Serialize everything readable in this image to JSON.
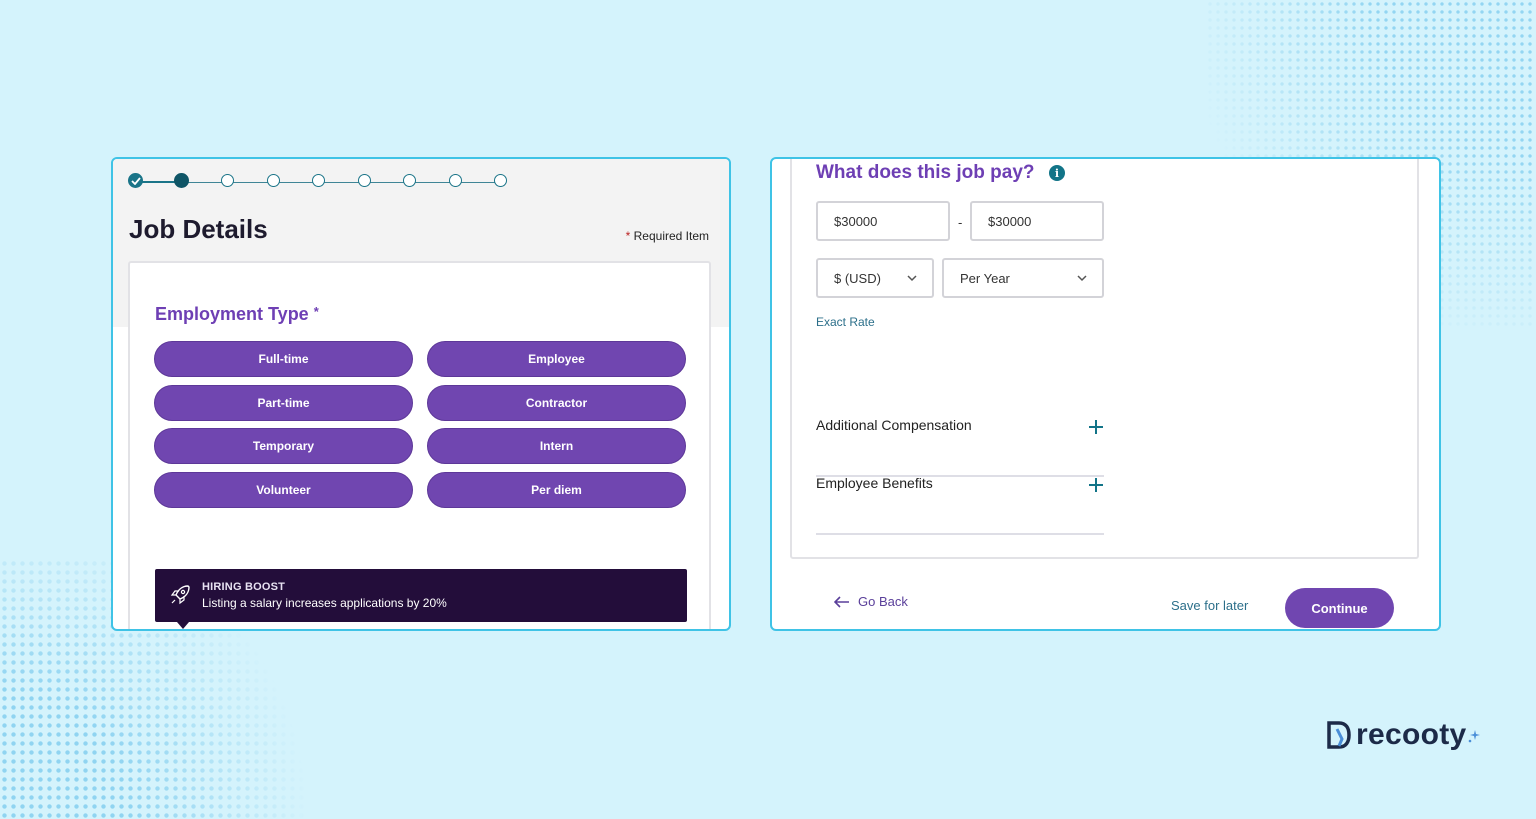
{
  "left": {
    "title": "Job Details",
    "required_star": "*",
    "required_label": "Required Item",
    "employment_heading": "Employment Type",
    "employment_star": "*",
    "options": [
      "Full-time",
      "Employee",
      "Part-time",
      "Contractor",
      "Temporary",
      "Intern",
      "Volunteer",
      "Per diem"
    ],
    "boost_title": "HIRING BOOST",
    "boost_text": "Listing a salary increases applications by 20%"
  },
  "right": {
    "heading": "What does this job pay?",
    "info_glyph": "i",
    "min_pay": "$30000",
    "dash": "-",
    "max_pay": "$30000",
    "currency": "$ (USD)",
    "period": "Per Year",
    "exact_rate": "Exact Rate",
    "additional_compensation": "Additional Compensation",
    "employee_benefits": "Employee Benefits",
    "go_back": "Go Back",
    "save_later": "Save for later",
    "continue": "Continue"
  },
  "brand": {
    "name": "recooty"
  },
  "icons": {
    "stepper": [
      "check-icon"
    ],
    "info": "info-icon",
    "dropdown": "chevron-down-icon",
    "expand": "plus-icon",
    "back": "arrow-left-icon",
    "boost": "rocket-icon"
  },
  "stepper": {
    "total_steps": 9,
    "completed": 1,
    "current": 2
  },
  "colors": {
    "background": "#d4f3fc",
    "accent": "#7046b0",
    "teal": "#1a7488",
    "panel_border": "#3fc3e6",
    "boost_bg": "#230d3a"
  }
}
